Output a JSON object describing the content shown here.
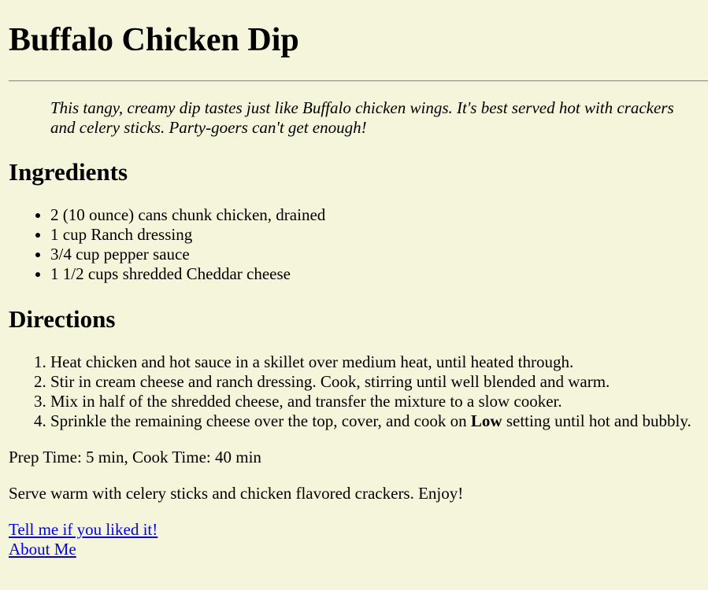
{
  "title": "Buffalo Chicken Dip",
  "description": "This tangy, creamy dip tastes just like Buffalo chicken wings. It's best served hot with crackers and celery sticks. Party-goers can't get enough!",
  "ingredients": {
    "heading": "Ingredients",
    "items": [
      "2 (10 ounce) cans chunk chicken, drained",
      "1 cup Ranch dressing",
      "3/4 cup pepper sauce",
      "1 1/2 cups shredded Cheddar cheese"
    ]
  },
  "directions": {
    "heading": "Directions",
    "steps": [
      "Heat chicken and hot sauce in a skillet over medium heat, until heated through.",
      "Stir in cream cheese and ranch dressing. Cook, stirring until well blended and warm.",
      "Mix in half of the shredded cheese, and transfer the mixture to a slow cooker."
    ],
    "step4_before": "Sprinkle the remaining cheese over the top, cover, and cook on ",
    "step4_bold": "Low",
    "step4_after": " setting until hot and bubbly."
  },
  "prep_time": "Prep Time: 5 min, Cook Time: 40 min",
  "serving_note": "Serve warm with celery sticks and chicken flavored crackers. Enjoy!",
  "links": {
    "feedback": "Tell me if you liked it!",
    "about": "About Me"
  },
  "colors": {
    "background": "#f5f5dc",
    "link": "#0000ee"
  }
}
